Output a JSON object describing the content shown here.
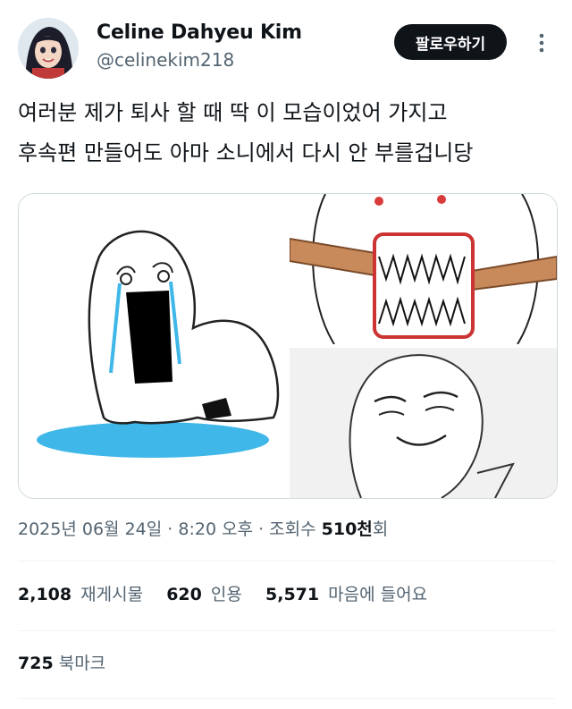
{
  "author": {
    "name": "Celine Dahyeu Kim",
    "handle": "@celinekim218"
  },
  "follow_button": "팔로우하기",
  "tweet": {
    "lines": [
      "여러분 제가 퇴사 할 때 딱 이 모습이었어 가지고",
      "후속편 만들어도 아마 소니에서 다시 안 부를겁니당"
    ]
  },
  "meta": {
    "date": "2025년 06월 24일",
    "sep1": " · ",
    "time": "8:20 오후",
    "sep2": " · ",
    "views_label": "조회수 ",
    "views_number": "510천",
    "views_suffix": "회"
  },
  "stats": {
    "retweets_count": "2,108",
    "retweets_label": "재게시물",
    "quotes_count": "620",
    "quotes_label": "인용",
    "likes_count": "5,571",
    "likes_label": "마음에 들어요"
  },
  "bookmarks": {
    "count": "725",
    "label": "북마크"
  },
  "icons": {
    "more": "more-vertical-icon"
  }
}
